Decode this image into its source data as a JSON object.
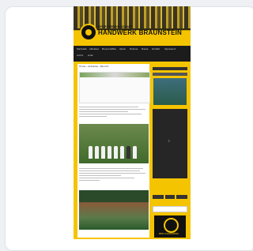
{
  "site": {
    "brand_small": "SPORTVEREIN SCHAFT",
    "brand_big": "HANDWERK BRAUNSTEIN"
  },
  "nav": {
    "items": [
      "Startseite",
      "Aktuelles",
      "Mannschaften",
      "Verein",
      "Termine",
      "Presse",
      "Kontakt",
      "Impressum",
      "Archiv",
      "Links"
    ]
  },
  "main": {
    "breadcrumb": "Home › Aktuelles › Bericht"
  },
  "sidebar": {
    "arrow": "›"
  },
  "crest": {
    "text": "BEN HANDWERK"
  }
}
